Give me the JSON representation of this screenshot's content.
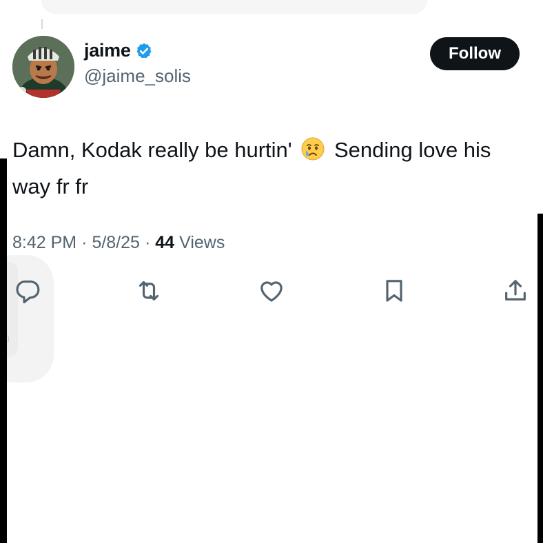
{
  "author": {
    "display_name": "jaime",
    "handle": "@jaime_solis",
    "verified": true,
    "avatar_icon": "avatar-cyclist-illustration"
  },
  "follow_button": {
    "label": "Follow"
  },
  "tweet": {
    "text_before_emoji": "Damn, Kodak really be hurtin'",
    "emoji_icon": "crying-face-emoji",
    "text_after_emoji": "Sending love his way fr fr"
  },
  "meta": {
    "time": "8:42 PM",
    "separator": "·",
    "date": "5/8/25",
    "views_count": "44",
    "views_label": "Views"
  },
  "actions": [
    {
      "icon": "reply-icon"
    },
    {
      "icon": "retweet-icon"
    },
    {
      "icon": "like-icon"
    },
    {
      "icon": "bookmark-icon"
    },
    {
      "icon": "share-icon"
    }
  ],
  "colors": {
    "text_primary": "#0f1419",
    "text_secondary": "#536471",
    "verified_blue": "#1d9bf0",
    "button_bg": "#0f1419",
    "button_text": "#ffffff"
  }
}
